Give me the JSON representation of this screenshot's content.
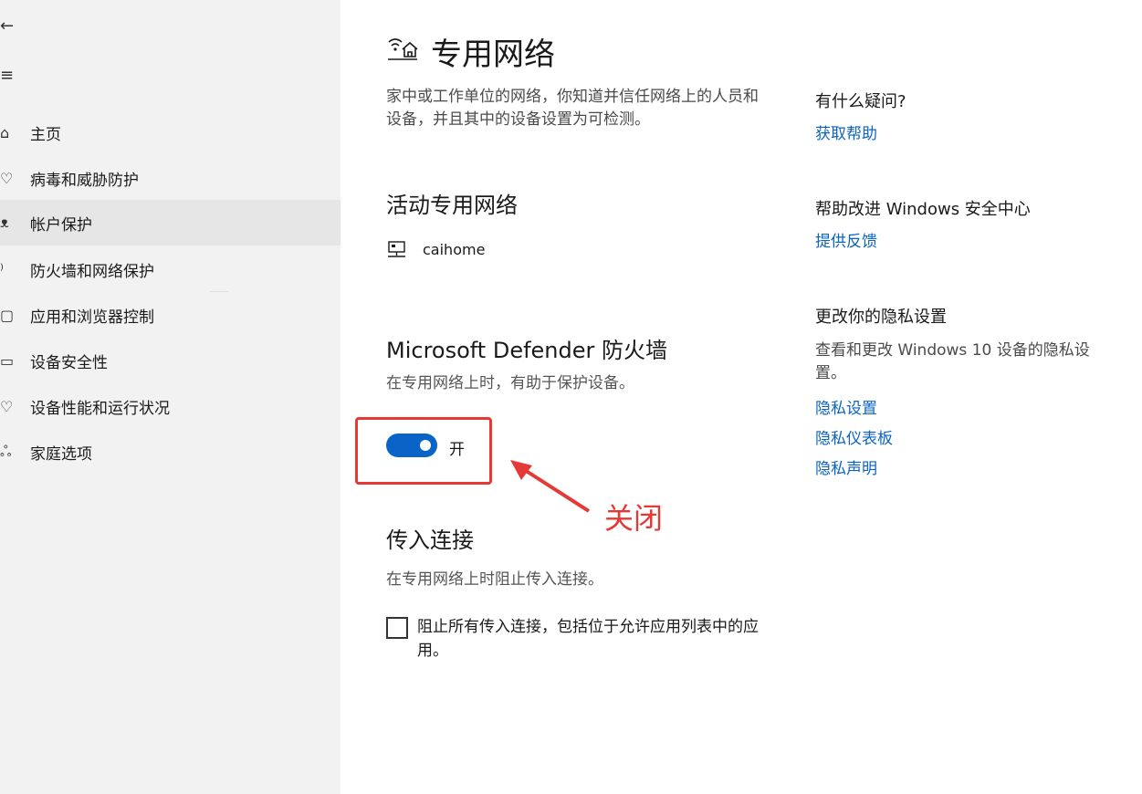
{
  "sidebar": {
    "back_icon": "←",
    "menu_icon": "≡",
    "items": [
      {
        "label": "主页",
        "icon": "home-icon",
        "glyph": "⌂"
      },
      {
        "label": "病毒和威胁防护",
        "icon": "shield-icon",
        "glyph": "♡"
      },
      {
        "label": "帐户保护",
        "icon": "person-icon",
        "glyph": "ᴥ"
      },
      {
        "label": "防火墙和网络保护",
        "icon": "wifi-icon",
        "glyph": "⁾"
      },
      {
        "label": "应用和浏览器控制",
        "icon": "app-window-icon",
        "glyph": "▢"
      },
      {
        "label": "设备安全性",
        "icon": "laptop-icon",
        "glyph": "▭"
      },
      {
        "label": "设备性能和运行状况",
        "icon": "heart-icon",
        "glyph": "♡"
      },
      {
        "label": "家庭选项",
        "icon": "family-icon",
        "glyph": "ஃ"
      }
    ],
    "selected_index": 2
  },
  "main": {
    "title": "专用网络",
    "description": "家中或工作单位的网络，你知道并信任网络上的人员和设备，并且其中的设备设置为可检测。",
    "active_networks_heading": "活动专用网络",
    "active_network_name": "caihome",
    "firewall_heading": "Microsoft Defender 防火墙",
    "firewall_desc": "在专用网络上时，有助于保护设备。",
    "firewall_toggle_label": "开",
    "firewall_toggle_on": true,
    "incoming_heading": "传入连接",
    "incoming_desc": "在专用网络上时阻止传入连接。",
    "incoming_checkbox_label": "阻止所有传入连接，包括位于允许应用列表中的应用。",
    "incoming_checked": false
  },
  "annotation": {
    "text": "关闭",
    "color": "#e53935"
  },
  "right_panel": {
    "questions_heading": "有什么疑问?",
    "get_help_link": "获取帮助",
    "improve_heading": "帮助改进 Windows 安全中心",
    "feedback_link": "提供反馈",
    "privacy_heading": "更改你的隐私设置",
    "privacy_text": "查看和更改 Windows 10 设备的隐私设置。",
    "privacy_settings_link": "隐私设置",
    "privacy_dashboard_link": "隐私仪表板",
    "privacy_statement_link": "隐私声明"
  },
  "colors": {
    "accent": "#0a64c8",
    "link": "#0b63c1",
    "sidebar_bg": "#f2f2f2",
    "selected_bg": "#e6e6e6"
  }
}
